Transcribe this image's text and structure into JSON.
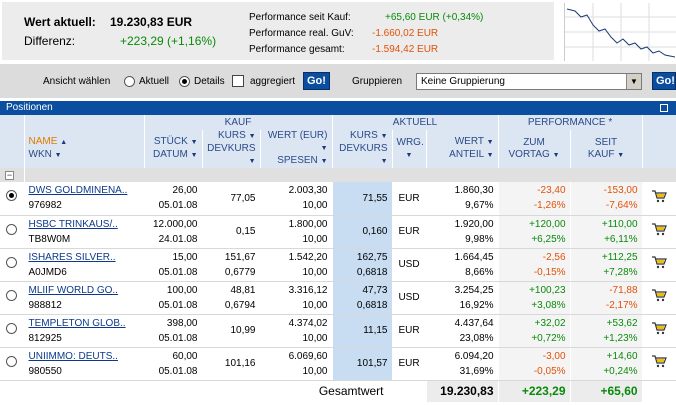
{
  "summary": {
    "wert_label": "Wert aktuell:",
    "wert_value": "19.230,83 EUR",
    "diff_label": "Differenz:",
    "diff_value": "+223,29 (+1,16%)",
    "perf_kauf_label": "Performance seit Kauf:",
    "perf_kauf_value": "+65,60 EUR (+0,34%)",
    "perf_guv_label": "Performance real. GuV:",
    "perf_guv_value": "-1.660,02 EUR",
    "perf_ges_label": "Performance gesamt:",
    "perf_ges_value": "-1.594,42 EUR"
  },
  "controls": {
    "ansicht_label": "Ansicht wählen",
    "aktuell_label": "Aktuell",
    "details_label": "Details",
    "aggregiert_label": "aggregiert",
    "go_label": "Go!",
    "gruppieren_label": "Gruppieren",
    "gruppieren_value": "Keine Gruppierung",
    "go2_label": "Go!"
  },
  "positionen_label": "Positionen",
  "groups": {
    "kauf": "KAUF",
    "aktuell": "AKTUELL",
    "performance": "PERFORMANCE *"
  },
  "headers": {
    "name": "NAME",
    "wkn": "WKN",
    "stueck": "STÜCK",
    "datum": "DATUM",
    "kurs1": "KURS",
    "devkurs1": "DEVKURS",
    "wert_eur": "WERT (EUR)",
    "spesen": "SPESEN",
    "kurs2": "KURS",
    "devkurs2": "DEVKURS",
    "wrg": "WRG.",
    "wert": "WERT",
    "anteil": "ANTEIL",
    "zum": "ZUM",
    "vortag": "VORTAG",
    "seit": "SEIT",
    "kauf": "KAUF"
  },
  "rows": [
    {
      "name": "DWS GOLDMINENA..",
      "wkn": "976982",
      "stueck": "26,00",
      "datum": "05.01.08",
      "kurs": "77,05",
      "devkurs": "",
      "wert_eur": "2.003,30",
      "spesen": "10,00",
      "akt_kurs": "71,55",
      "akt_devkurs": "",
      "wrg": "EUR",
      "wert": "1.860,30",
      "anteil": "9,67%",
      "vortag_abs": "-23,40",
      "vortag_pct": "-1,26%",
      "kauf_abs": "-153,00",
      "kauf_pct": "-7,64%",
      "selected": true
    },
    {
      "name": "HSBC TRINKAUS/..",
      "wkn": "TB8W0M",
      "stueck": "12.000,00",
      "datum": "24.01.08",
      "kurs": "0,15",
      "devkurs": "",
      "wert_eur": "1.800,00",
      "spesen": "10,00",
      "akt_kurs": "0,160",
      "akt_devkurs": "",
      "wrg": "EUR",
      "wert": "1.920,00",
      "anteil": "9,98%",
      "vortag_abs": "+120,00",
      "vortag_pct": "+6,25%",
      "kauf_abs": "+110,00",
      "kauf_pct": "+6,11%",
      "selected": false
    },
    {
      "name": "ISHARES SILVER..",
      "wkn": "A0JMD6",
      "stueck": "15,00",
      "datum": "05.01.08",
      "kurs": "151,67",
      "devkurs": "0,6779",
      "wert_eur": "1.542,20",
      "spesen": "10,00",
      "akt_kurs": "162,75",
      "akt_devkurs": "0,6818",
      "wrg": "USD",
      "wert": "1.664,45",
      "anteil": "8,66%",
      "vortag_abs": "-2,56",
      "vortag_pct": "-0,15%",
      "kauf_abs": "+112,25",
      "kauf_pct": "+7,28%",
      "selected": false
    },
    {
      "name": "MLIIF WORLD GO..",
      "wkn": "988812",
      "stueck": "100,00",
      "datum": "05.01.08",
      "kurs": "48,81",
      "devkurs": "0,6794",
      "wert_eur": "3.316,12",
      "spesen": "10,00",
      "akt_kurs": "47,73",
      "akt_devkurs": "0,6818",
      "wrg": "USD",
      "wert": "3.254,25",
      "anteil": "16,92%",
      "vortag_abs": "+100,23",
      "vortag_pct": "+3,08%",
      "kauf_abs": "-71,88",
      "kauf_pct": "-2,17%",
      "selected": false
    },
    {
      "name": "TEMPLETON GLOB..",
      "wkn": "812925",
      "stueck": "398,00",
      "datum": "05.01.08",
      "kurs": "10,99",
      "devkurs": "",
      "wert_eur": "4.374,02",
      "spesen": "10,00",
      "akt_kurs": "11,15",
      "akt_devkurs": "",
      "wrg": "EUR",
      "wert": "4.437,64",
      "anteil": "23,08%",
      "vortag_abs": "+32,02",
      "vortag_pct": "+0,72%",
      "kauf_abs": "+53,62",
      "kauf_pct": "+1,23%",
      "selected": false
    },
    {
      "name": "UNIIMMO: DEUTS..",
      "wkn": "980550",
      "stueck": "60,00",
      "datum": "05.01.08",
      "kurs": "101,16",
      "devkurs": "",
      "wert_eur": "6.069,60",
      "spesen": "10,00",
      "akt_kurs": "101,57",
      "akt_devkurs": "",
      "wrg": "EUR",
      "wert": "6.094,20",
      "anteil": "31,69%",
      "vortag_abs": "-3,00",
      "vortag_pct": "-0,05%",
      "kauf_abs": "+14,60",
      "kauf_pct": "+0,24%",
      "selected": false
    }
  ],
  "total": {
    "label": "Gesamtwert",
    "wert": "19.230,83",
    "vortag": "+223,29",
    "kauf": "+65,60"
  },
  "colors": {
    "accent": "#0b4ea0",
    "positive": "#0a8a0a",
    "negative": "#e0520a",
    "header_bg": "#dce6f2",
    "highlight": "#c8ddf2"
  }
}
